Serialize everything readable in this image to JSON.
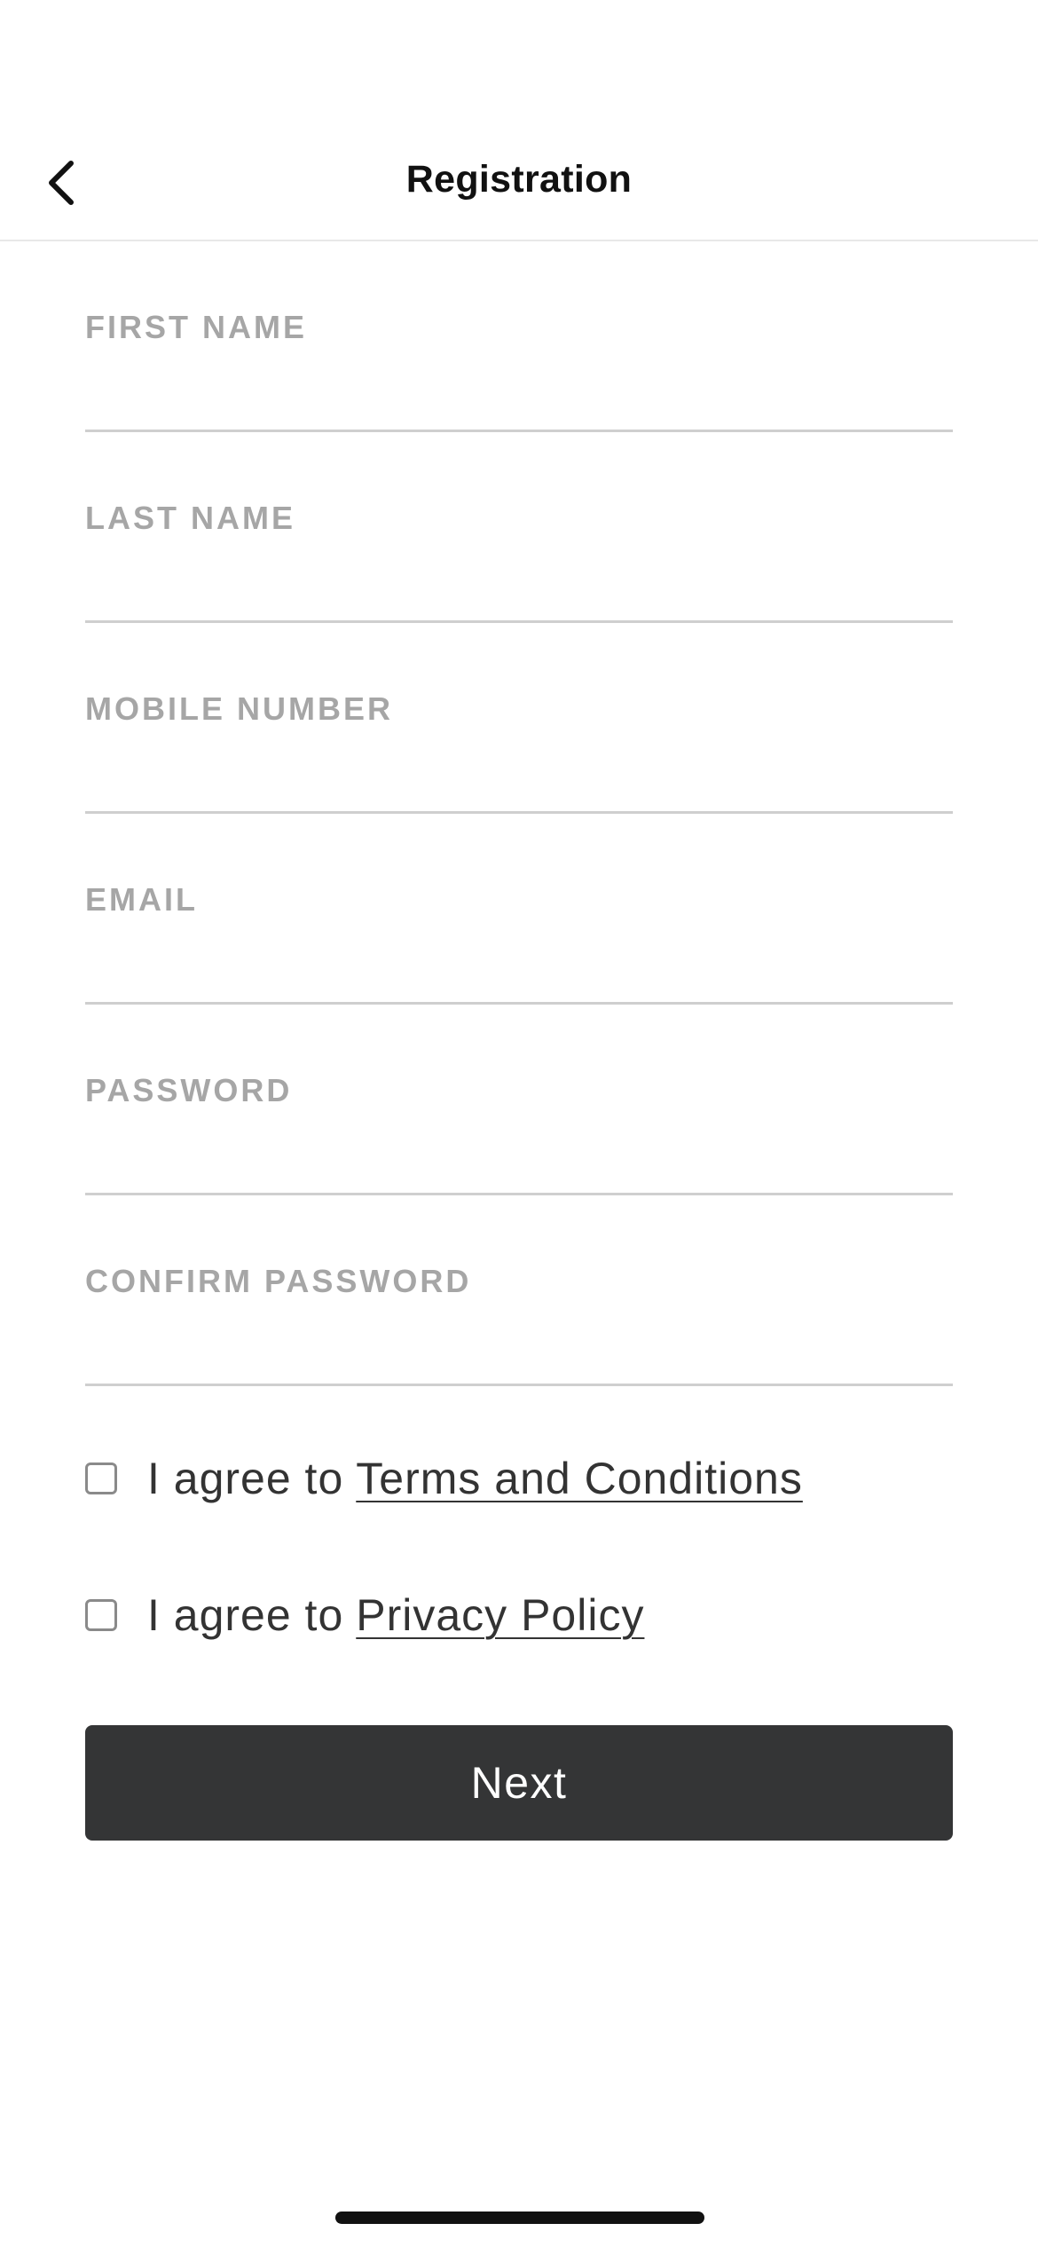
{
  "nav": {
    "title": "Registration",
    "back_icon": "chevron-left-icon"
  },
  "form": {
    "fields": [
      {
        "label": "FIRST NAME",
        "value": ""
      },
      {
        "label": "LAST NAME",
        "value": ""
      },
      {
        "label": "MOBILE NUMBER",
        "value": ""
      },
      {
        "label": "EMAIL",
        "value": ""
      },
      {
        "label": "PASSWORD",
        "value": ""
      },
      {
        "label": "CONFIRM PASSWORD",
        "value": ""
      }
    ]
  },
  "agreements": {
    "terms": {
      "prefix": "I agree to",
      "link": "Terms and Conditions",
      "checked": false
    },
    "privacy": {
      "prefix": "I agree to",
      "link": "Privacy Policy",
      "checked": false
    }
  },
  "actions": {
    "next_label": "Next"
  },
  "colors": {
    "button_bg": "#343536",
    "label_gray": "#a6a6a6",
    "divider": "#cfcfcf"
  }
}
